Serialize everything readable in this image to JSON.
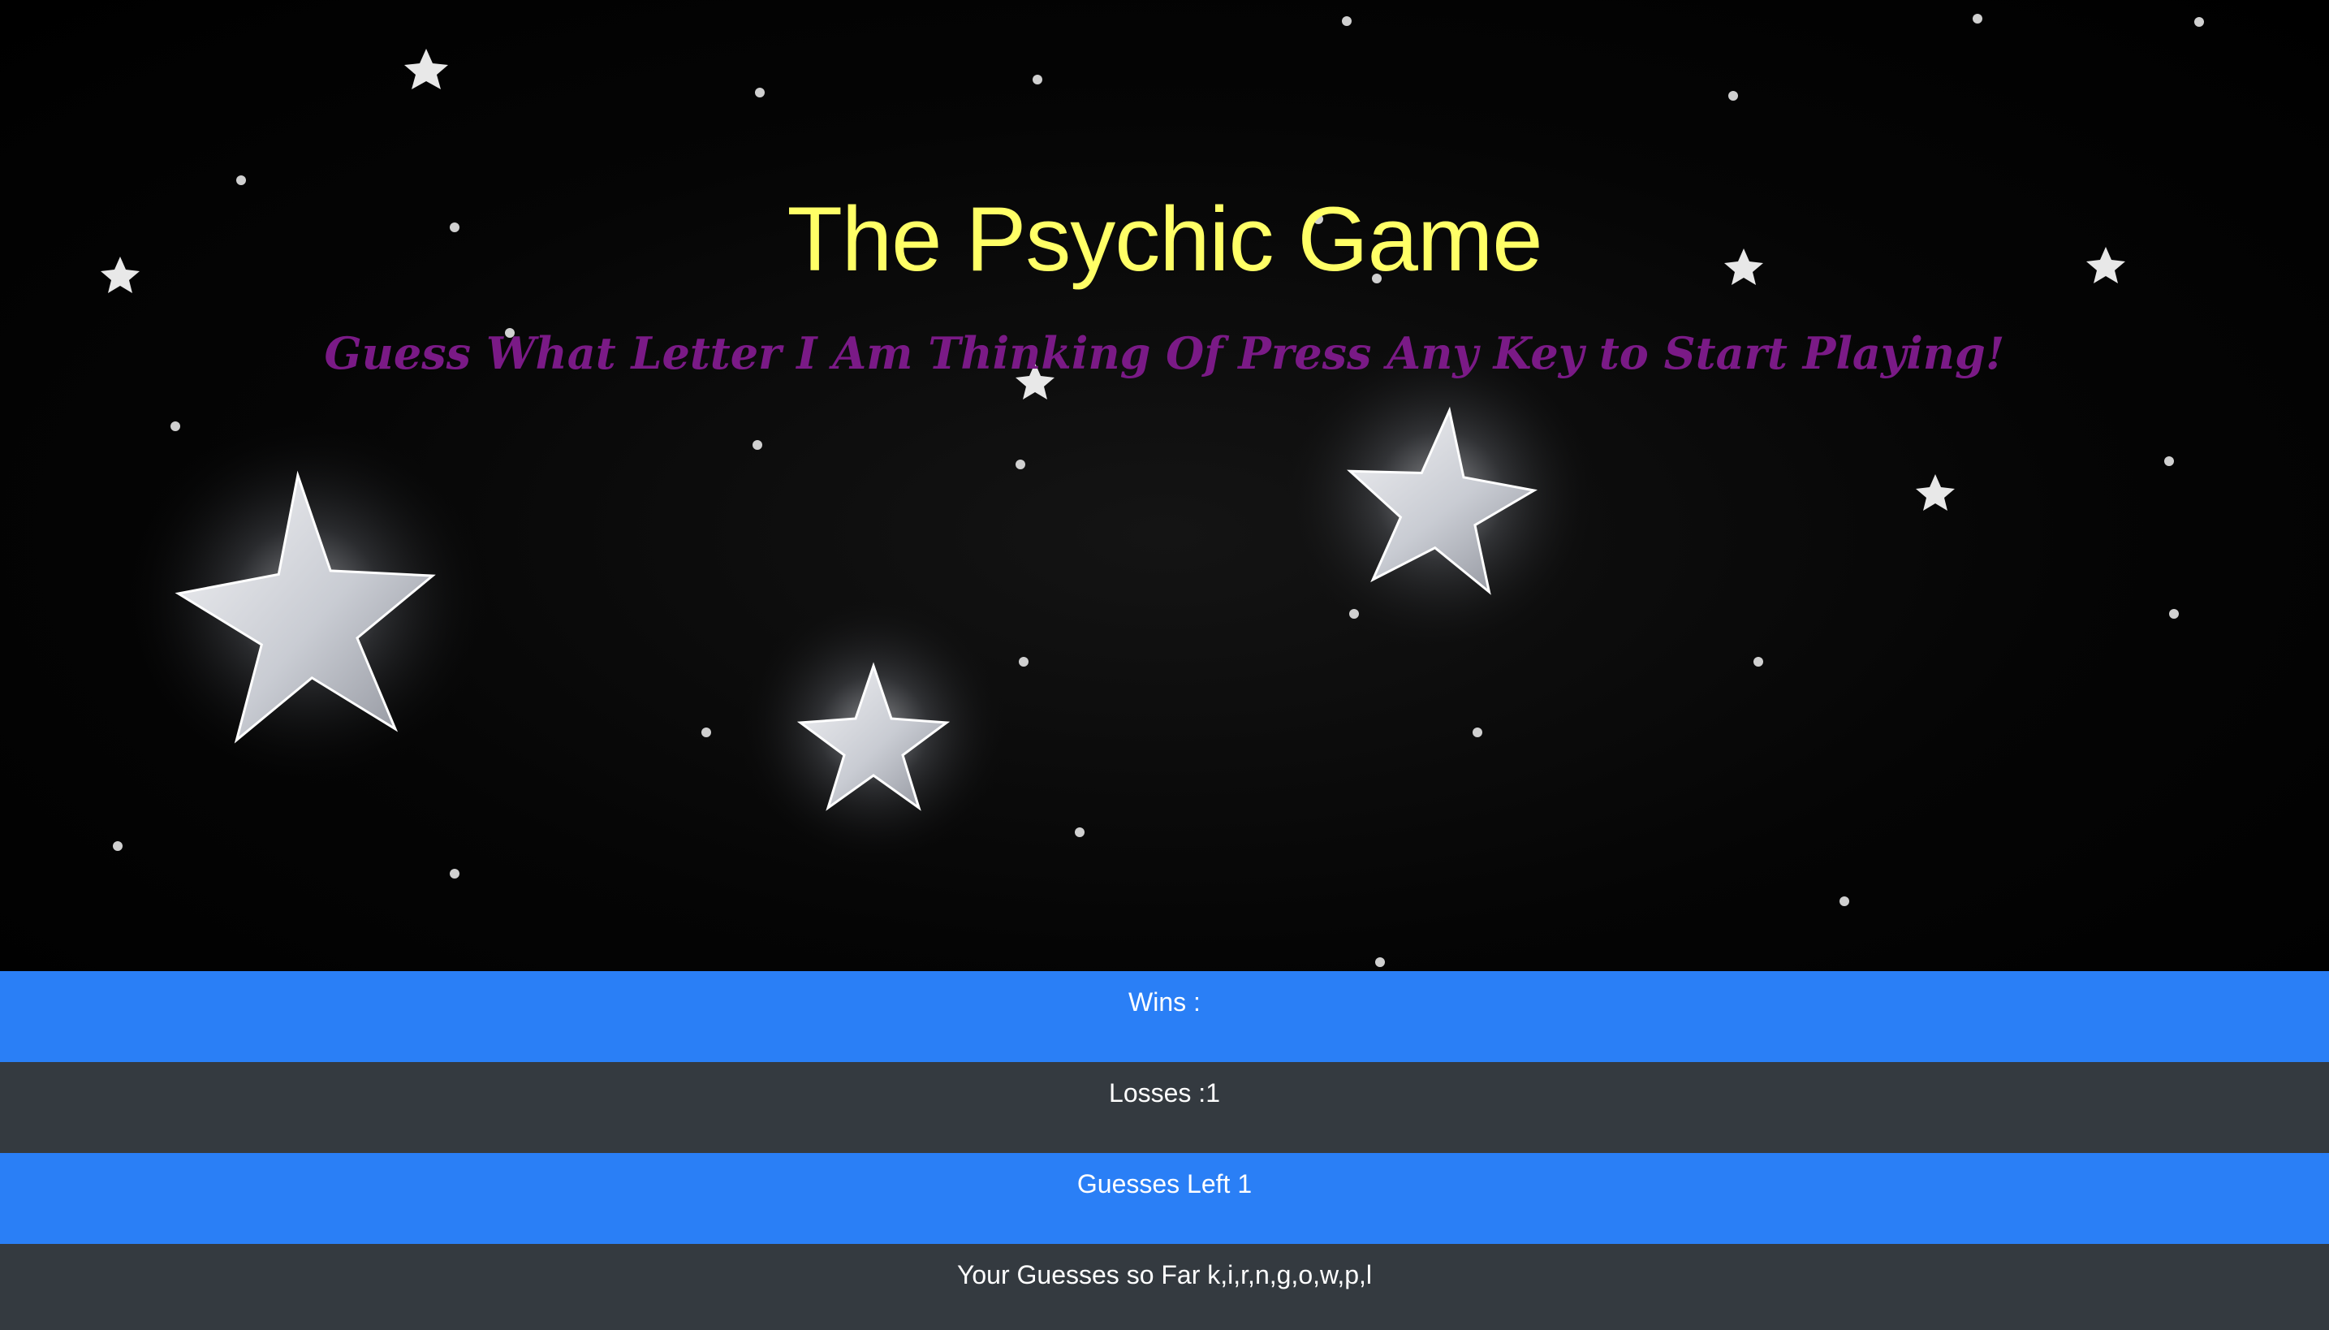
{
  "header": {
    "title": "The Psychic Game",
    "subtitle": "Guess What Letter I Am Thinking Of Press Any Key to Start Playing!"
  },
  "stats": {
    "wins_label": "Wins :",
    "losses_label": "Losses :1",
    "guesses_left_label": "Guesses Left 1",
    "guesses_so_far_label": "Your Guesses so Far k,i,r,n,g,o,w,p,l"
  },
  "colors": {
    "title": "#ffff66",
    "subtitle": "#7a1a86",
    "blue_bar": "#2a7ff6",
    "gray_bar": "#343a40"
  },
  "background": {
    "icon": "hanging-stars-icon"
  }
}
